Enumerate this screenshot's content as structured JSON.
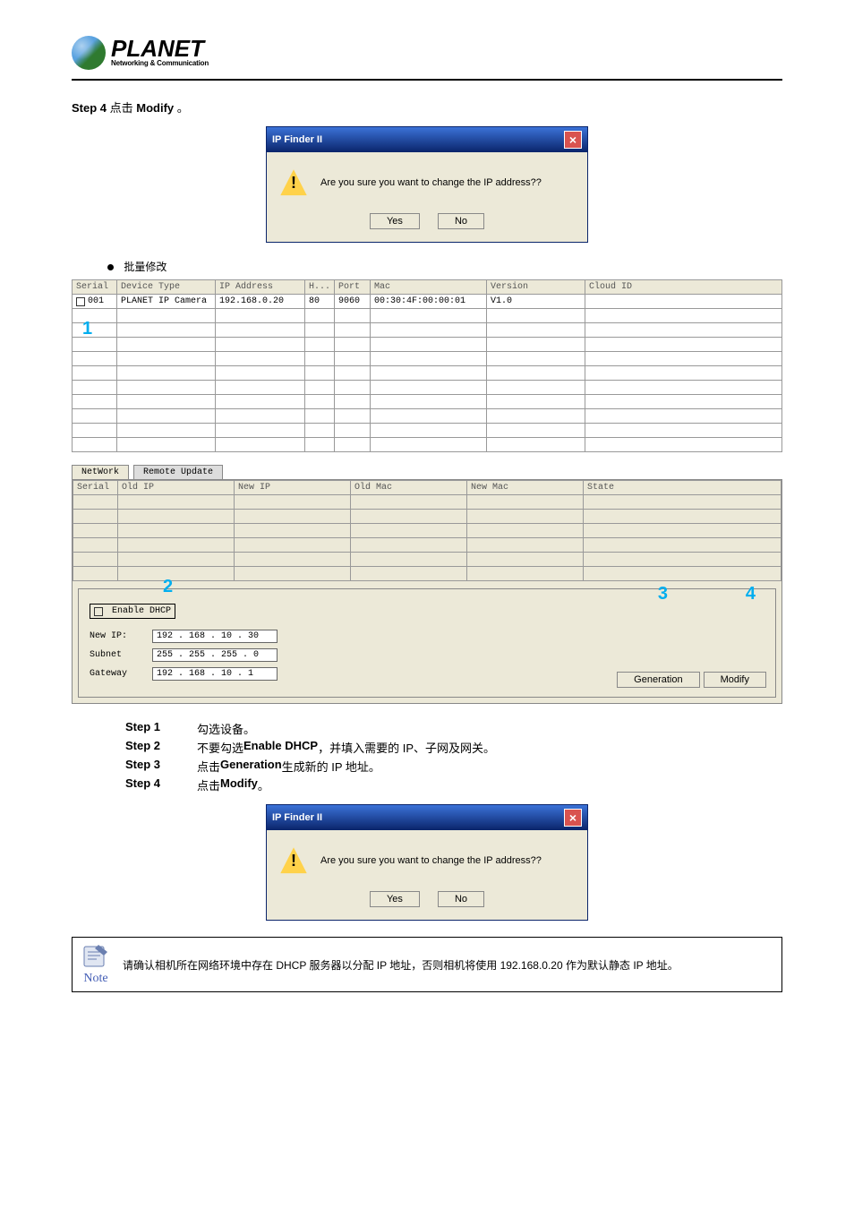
{
  "logo": {
    "brand": "PLANET",
    "tagline": "Networking & Communication"
  },
  "dialog1": {
    "title": "IP Finder II",
    "message": "Are you sure you want to change the IP address??",
    "yes": "Yes",
    "no": "No"
  },
  "bullet_text": "批量修改",
  "device_table": {
    "headers": {
      "serial": "Serial",
      "device_type": "Device Type",
      "ip": "IP Address",
      "h": "H...",
      "port": "Port",
      "mac": "Mac",
      "version": "Version",
      "cloud": "Cloud ID"
    },
    "row": {
      "serial": "001",
      "device_type": "PLANET IP Camera",
      "ip": "192.168.0.20",
      "h": "80",
      "port": "9060",
      "mac": "00:30:4F:00:00:01",
      "version": "V1.0",
      "cloud": ""
    }
  },
  "tabs": {
    "network": "NetWork",
    "remote": "Remote Update"
  },
  "change_table": {
    "headers": {
      "serial": "Serial",
      "old_ip": "Old IP",
      "new_ip": "New IP",
      "old_mac": "Old Mac",
      "new_mac": "New Mac",
      "state": "State"
    }
  },
  "settings": {
    "enable_dhcp": "Enable DHCP",
    "new_ip_label": "New IP:",
    "new_ip": "192 . 168 .  10  .  30",
    "subnet_label": "Subnet",
    "subnet": "255 . 255 . 255 .   0",
    "gateway_label": "Gateway",
    "gateway": "192 . 168 .  10  .   1",
    "generation_btn": "Generation",
    "modify_btn": "Modify"
  },
  "callouts": {
    "one": "1",
    "two": "2",
    "three": "3",
    "four": "4"
  },
  "steps": {
    "s1": {
      "key": "Step 1",
      "mid": "勾选设备。",
      "action": ""
    },
    "s2": {
      "key": "Step 2",
      "mid": "不要勾选 ",
      "action": "Enable DHCP",
      "tail": "，并填入需要的 IP、子网及网关。"
    },
    "s3": {
      "key": "Step 3",
      "mid": "点击 ",
      "action": "Generation",
      "tail": " 生成新的 IP 地址。"
    },
    "s4": {
      "key": "Step 4",
      "mid": "点击 ",
      "action": "Modify",
      "tail": "。"
    }
  },
  "dialog2": {
    "title": "IP Finder II",
    "message": "Are you sure you want to change the IP address??",
    "yes": "Yes",
    "no": "No"
  },
  "note": {
    "label": "Note",
    "text": "请确认相机所在网络环境中存在 DHCP 服务器以分配 IP 地址，否则相机将使用 192.168.0.20 作为默认静态 IP 地址。"
  }
}
